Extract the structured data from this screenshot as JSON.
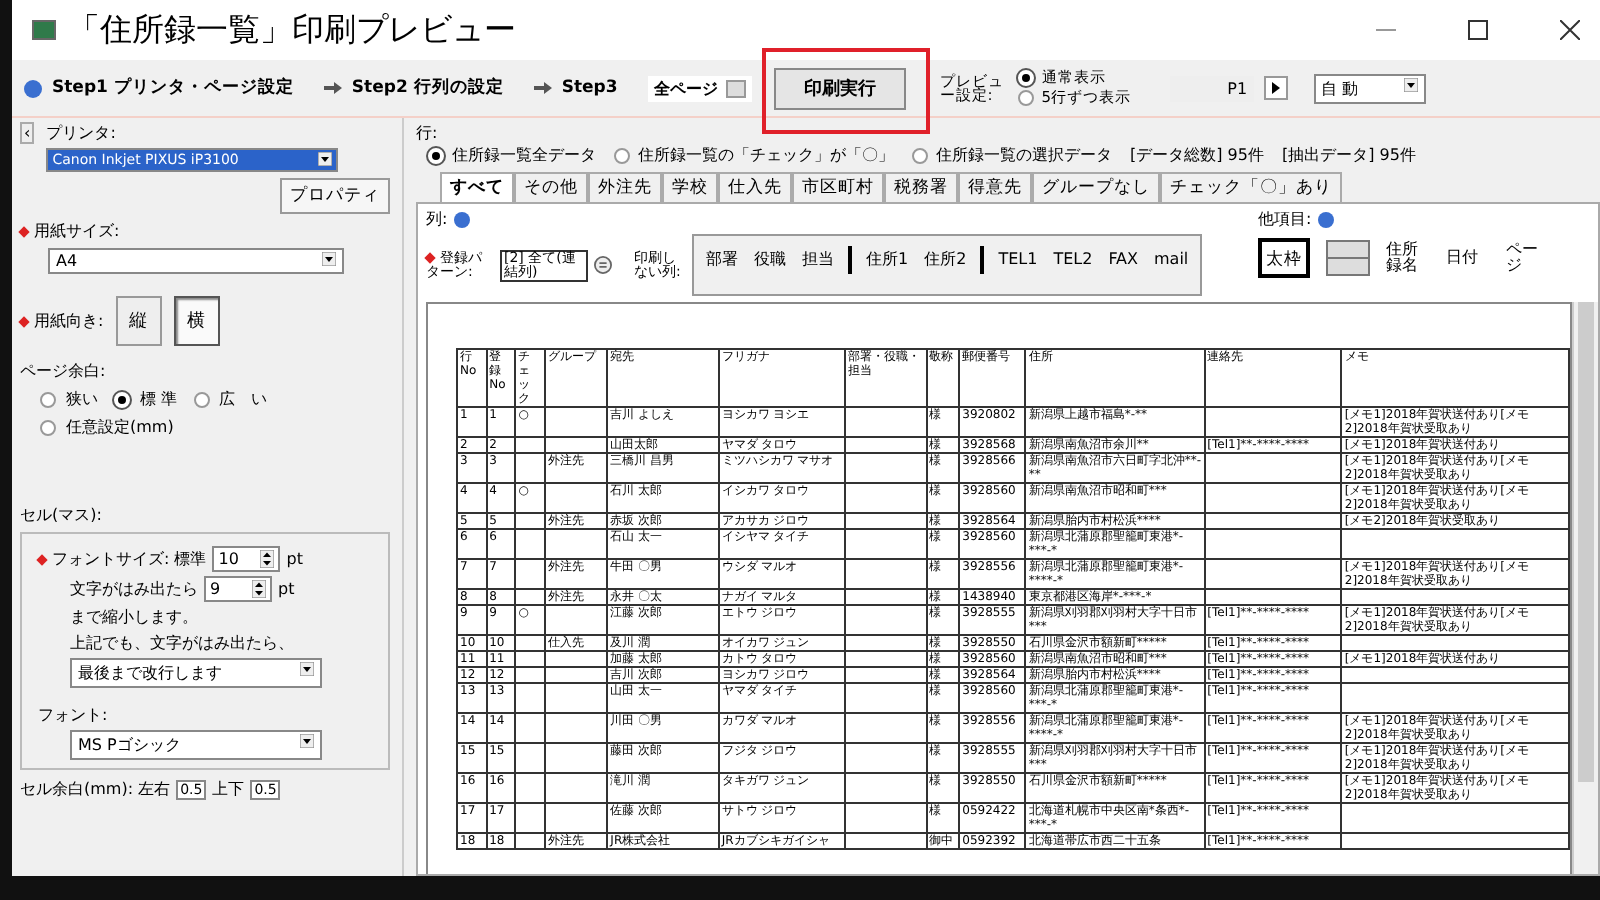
{
  "window": {
    "title": "「住所録一覧」印刷プレビュー"
  },
  "steps": [
    {
      "label": "Step1 プリンタ・ページ設定"
    },
    {
      "label": "Step2 行列の設定"
    },
    {
      "label": "Step3"
    }
  ],
  "page_range": {
    "value": "全ページ"
  },
  "print_button": {
    "label": "印刷実行",
    "highlighted": true
  },
  "preview_setting": {
    "label": "プレビュー設定:",
    "options": [
      {
        "label": "通常表示",
        "selected": true
      },
      {
        "label": "5行ずつ表示",
        "selected": false
      }
    ],
    "page": "P1",
    "zoom": "自 動"
  },
  "left_panel": {
    "collapse": "‹",
    "printer_label": "プリンタ:",
    "printer": "Canon Inkjet PIXUS iP3100",
    "properties_button": "プロパティ",
    "paper_size_label": "用紙サイズ:",
    "paper_size": "A4",
    "orientation_label": "用紙向き:",
    "orientations": [
      {
        "label": "縦",
        "selected": false
      },
      {
        "label": "横",
        "selected": true
      }
    ],
    "margin_label": "ページ余白:",
    "margins": [
      {
        "label": "狭い",
        "selected": false
      },
      {
        "label": "標 準",
        "selected": true
      },
      {
        "label": "広　い",
        "selected": false
      },
      {
        "label": "任意設定(mm)",
        "selected": false
      }
    ],
    "cell_label": "セル(マス):",
    "font_size_label": "フォントサイズ: 標準",
    "font_size": "10",
    "pt": "pt",
    "shrink_before": "文字がはみ出たら",
    "shrink_size": "9",
    "shrink_pt": "pt",
    "shrink_after": "まで縮小します。",
    "overflow_label": "上記でも、文字がはみ出たら、",
    "overflow": "最後まで改行します",
    "font_label": "フォント:",
    "font": "MS Pゴシック",
    "cell_margin_label": "セル余白(mm): 左右",
    "cell_margin_lr": "0.5",
    "cell_margin_tb_label": "上下",
    "cell_margin_tb": "0.5"
  },
  "rows_filter": {
    "label": "行:",
    "options": [
      {
        "label": "住所録一覧全データ",
        "selected": true
      },
      {
        "label": "住所録一覧の「チェック」が「〇」",
        "selected": false
      },
      {
        "label": "住所録一覧の選択データ",
        "selected": false
      }
    ],
    "total": "[データ総数] 95件",
    "extracted": "[抽出データ] 95件"
  },
  "tabs": [
    {
      "label": "すべて",
      "selected": true
    },
    {
      "label": "その他",
      "selected": false
    },
    {
      "label": "外注先",
      "selected": false
    },
    {
      "label": "学校",
      "selected": false
    },
    {
      "label": "仕入先",
      "selected": false
    },
    {
      "label": "市区町村",
      "selected": false
    },
    {
      "label": "税務署",
      "selected": false
    },
    {
      "label": "得意先",
      "selected": false
    },
    {
      "label": "グループなし",
      "selected": false
    },
    {
      "label": "チェック「〇」あり",
      "selected": false
    }
  ],
  "columns_setting": {
    "label": "列:",
    "pattern_label": "登録パターン:",
    "pattern": "[2] 全て(連結列)",
    "hidden_label": "印刷しない列:",
    "hidden_columns": [
      {
        "label": "部署",
        "divider_before": false
      },
      {
        "label": "役職",
        "divider_before": false
      },
      {
        "label": "担当",
        "divider_before": false
      },
      {
        "label": "住所1",
        "divider_before": true
      },
      {
        "label": "住所2",
        "divider_before": false
      },
      {
        "label": "TEL1",
        "divider_before": true
      },
      {
        "label": "TEL2",
        "divider_before": false
      },
      {
        "label": "FAX",
        "divider_before": false
      },
      {
        "label": "mail",
        "divider_before": false
      }
    ]
  },
  "other_items": {
    "label": "他項目:",
    "thick_frame": {
      "label": "太枠",
      "selected": true
    },
    "items": [
      "住所録名",
      "日付",
      "ページ"
    ]
  },
  "preview": {
    "columns": [
      "行No",
      "登録No",
      "チェック",
      "グループ",
      "宛先",
      "フリガナ",
      "部署・役職・担当",
      "敬称",
      "郵便番号",
      "住所",
      "連絡先",
      "メモ"
    ],
    "rows": [
      [
        "1",
        "1",
        "○",
        "",
        "吉川 よしえ",
        "ヨシカワ ヨシエ",
        "",
        "様",
        "3920802",
        "新潟県上越市福島*-**",
        "",
        "[メモ1]2018年賀状送付あり[メモ2]2018年賀状受取あり"
      ],
      [
        "2",
        "2",
        "",
        "",
        "山田太郎",
        "ヤマダ タロウ",
        "",
        "様",
        "3928568",
        "新潟県南魚沼市余川**",
        "[Tel1]**-****-****",
        "[メモ1]2018年賀状送付あり"
      ],
      [
        "3",
        "3",
        "",
        "外注先",
        "三橋川 昌男",
        "ミツハシカワ マサオ",
        "",
        "様",
        "3928566",
        "新潟県南魚沼市六日町字北沖**-**",
        "",
        "[メモ1]2018年賀状送付あり[メモ2]2018年賀状受取あり"
      ],
      [
        "4",
        "4",
        "○",
        "",
        "石川 太郎",
        "イシカワ タロウ",
        "",
        "様",
        "3928560",
        "新潟県南魚沼市昭和町***",
        "",
        "[メモ1]2018年賀状送付あり[メモ2]2018年賀状受取あり"
      ],
      [
        "5",
        "5",
        "",
        "外注先",
        "赤坂 次郎",
        "アカサカ ジロウ",
        "",
        "様",
        "3928564",
        "新潟県胎内市村松浜****",
        "",
        "[メモ2]2018年賀状受取あり"
      ],
      [
        "6",
        "6",
        "",
        "",
        "石山 太一",
        "イシヤマ タイチ",
        "",
        "様",
        "3928560",
        "新潟県北蒲原郡聖籠町東港*-***-*",
        "",
        ""
      ],
      [
        "7",
        "7",
        "",
        "外注先",
        "牛田 〇男",
        "ウシダ マルオ",
        "",
        "様",
        "3928556",
        "新潟県北蒲原郡聖籠町東港*-****-*",
        "",
        "[メモ1]2018年賀状送付あり[メモ2]2018年賀状受取あり"
      ],
      [
        "8",
        "8",
        "",
        "外注先",
        "永井 〇太",
        "ナガイ マルタ",
        "",
        "様",
        "1438940",
        "東京都港区海岸*-***-*",
        "",
        ""
      ],
      [
        "9",
        "9",
        "○",
        "",
        "江藤 次郎",
        "エトウ ジロウ",
        "",
        "様",
        "3928555",
        "新潟県刈羽郡刈羽村大字十日市***",
        "[Tel1]**-****-****",
        "[メモ1]2018年賀状送付あり[メモ2]2018年賀状受取あり"
      ],
      [
        "10",
        "10",
        "",
        "仕入先",
        "及川 潤",
        "オイカワ ジュン",
        "",
        "様",
        "3928550",
        "石川県金沢市額新町*****",
        "[Tel1]**-****-****",
        ""
      ],
      [
        "11",
        "11",
        "",
        "",
        "加藤 太郎",
        "カトウ タロウ",
        "",
        "様",
        "3928560",
        "新潟県南魚沼市昭和町***",
        "[Tel1]**-****-****",
        "[メモ1]2018年賀状送付あり"
      ],
      [
        "12",
        "12",
        "",
        "",
        "吉川 次郎",
        "ヨシカワ ジロウ",
        "",
        "様",
        "3928564",
        "新潟県胎内市村松浜****",
        "[Tel1]**-****-****",
        ""
      ],
      [
        "13",
        "13",
        "",
        "",
        "山田 太一",
        "ヤマダ タイチ",
        "",
        "様",
        "3928560",
        "新潟県北蒲原郡聖籠町東港*-***-*",
        "[Tel1]**-****-****",
        ""
      ],
      [
        "14",
        "14",
        "",
        "",
        "川田 〇男",
        "カワダ マルオ",
        "",
        "様",
        "3928556",
        "新潟県北蒲原郡聖籠町東港*-****-*",
        "[Tel1]**-****-****",
        "[メモ1]2018年賀状送付あり[メモ2]2018年賀状受取あり"
      ],
      [
        "15",
        "15",
        "",
        "",
        "藤田 次郎",
        "フジタ ジロウ",
        "",
        "様",
        "3928555",
        "新潟県刈羽郡刈羽村大字十日市***",
        "[Tel1]**-****-****",
        "[メモ1]2018年賀状送付あり[メモ2]2018年賀状受取あり"
      ],
      [
        "16",
        "16",
        "",
        "",
        "滝川 潤",
        "タキガワ ジュン",
        "",
        "様",
        "3928550",
        "石川県金沢市額新町*****",
        "[Tel1]**-****-****",
        "[メモ1]2018年賀状送付あり[メモ2]2018年賀状受取あり"
      ],
      [
        "17",
        "17",
        "",
        "",
        "佐藤 次郎",
        "サトウ ジロウ",
        "",
        "様",
        "0592422",
        "北海道札幌市中央区南*条西*-***-*",
        "[Tel1]**-****-****",
        ""
      ],
      [
        "18",
        "18",
        "",
        "外注先",
        "JR株式会社",
        "JRカブシキガイシャ",
        "",
        "御中",
        "0592392",
        "北海道帯広市西二十五条",
        "[Tel1]**-****-****",
        ""
      ]
    ]
  }
}
